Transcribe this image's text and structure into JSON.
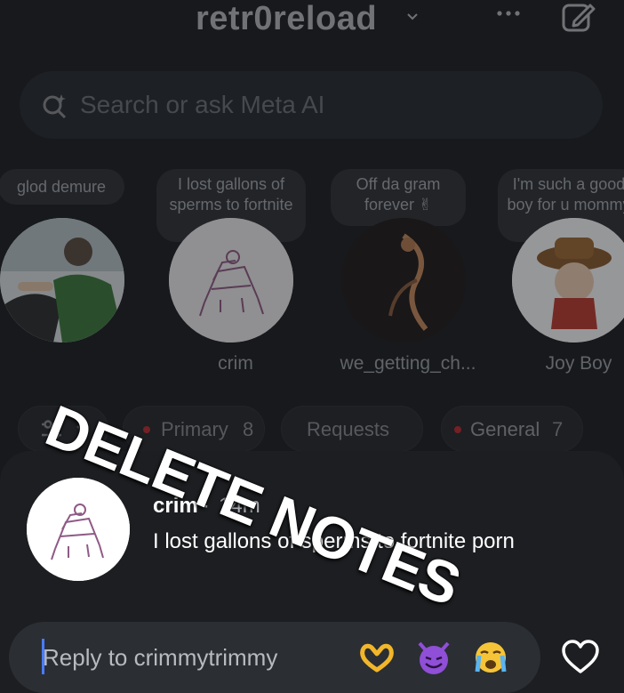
{
  "header": {
    "account_name": "retr0reload",
    "icons": [
      "chevron-down-icon",
      "more-icon",
      "edit-icon"
    ]
  },
  "search": {
    "placeholder": "Search or ask Meta AI",
    "icon": "meta-ai-search-icon"
  },
  "notes": [
    {
      "note": "glod demure",
      "username": ""
    },
    {
      "note": "I lost gallons of sperms to fortnite porn",
      "username": "crim"
    },
    {
      "note": "Off da gram forever ✌",
      "username": "we_getting_ch..."
    },
    {
      "note": "I'm such a good boy for u mommy",
      "username": "Joy Boy"
    }
  ],
  "overlay_text": "DELETE NOTES",
  "filters": [
    {
      "label": "Primary",
      "count": "8"
    },
    {
      "label": "Requests",
      "count": ""
    },
    {
      "label": "General",
      "count": "7"
    }
  ],
  "sheet": {
    "name": "crim",
    "separator": "·",
    "time": "14m",
    "note": "I lost gallons of sperms to fortnite porn",
    "reply_placeholder": "Reply to crimmytrimmy",
    "quick_reactions": [
      "🫶",
      "😈",
      "😭"
    ]
  },
  "colors": {
    "background": "#17191c",
    "surface": "#2b2e33",
    "accent_dot": "#c1272d",
    "caret": "#4a7bff"
  }
}
